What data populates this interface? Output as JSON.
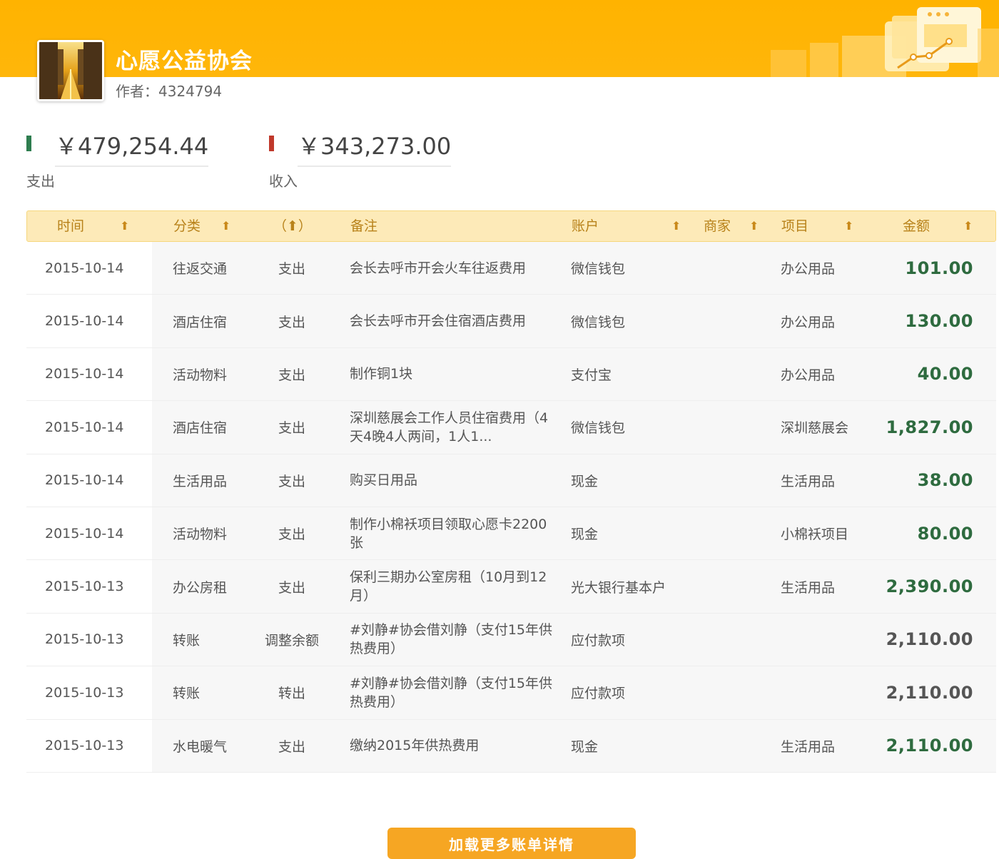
{
  "header": {
    "org_name": "心愿公益协会",
    "author": "作者：4324794"
  },
  "summary": {
    "expense_amount": "￥479,254.44",
    "expense_label": "支出",
    "expense_color": "#2e7d4f",
    "income_amount": "￥343,273.00",
    "income_label": "收入",
    "income_color": "#c0392b"
  },
  "table": {
    "headers": {
      "time": "时间",
      "category": "分类",
      "type": "（⬆）",
      "note": "备注",
      "account": "账户",
      "merchant": "商家",
      "project": "项目",
      "amount": "金额"
    },
    "sort_icon": "up-arrow-icon",
    "rows": [
      {
        "date": "2015-10-14",
        "category": "往返交通",
        "type": "支出",
        "note": "会长去呼市开会火车往返费用",
        "account": "微信钱包",
        "project": "办公用品",
        "amount": "101.00",
        "amount_color": "#2e6b3f"
      },
      {
        "date": "2015-10-14",
        "category": "酒店住宿",
        "type": "支出",
        "note": "会长去呼市开会住宿酒店费用",
        "account": "微信钱包",
        "project": "办公用品",
        "amount": "130.00",
        "amount_color": "#2e6b3f"
      },
      {
        "date": "2015-10-14",
        "category": "活动物料",
        "type": "支出",
        "note": "制作铜1块",
        "account": "支付宝",
        "project": "办公用品",
        "amount": "40.00",
        "amount_color": "#2e6b3f"
      },
      {
        "date": "2015-10-14",
        "category": "酒店住宿",
        "type": "支出",
        "note": "深圳慈展会工作人员住宿费用（4天4晚4人两间，1人1...",
        "account": "微信钱包",
        "project": "深圳慈展会",
        "amount": "1,827.00",
        "amount_color": "#2e6b3f"
      },
      {
        "date": "2015-10-14",
        "category": "生活用品",
        "type": "支出",
        "note": "购买日用品",
        "account": "现金",
        "project": "生活用品",
        "amount": "38.00",
        "amount_color": "#2e6b3f"
      },
      {
        "date": "2015-10-14",
        "category": "活动物料",
        "type": "支出",
        "note": "制作小棉袄项目领取心愿卡2200张",
        "account": "现金",
        "project": "小棉袄项目",
        "amount": "80.00",
        "amount_color": "#2e6b3f"
      },
      {
        "date": "2015-10-13",
        "category": "办公房租",
        "type": "支出",
        "note": "保利三期办公室房租（10月到12月）",
        "account": "光大银行基本户",
        "project": "生活用品",
        "amount": "2,390.00",
        "amount_color": "#2e6b3f"
      },
      {
        "date": "2015-10-13",
        "category": "转账",
        "type": "调整余额",
        "note": "#刘静#协会借刘静（支付15年供热费用）",
        "account": "应付款项",
        "project": "",
        "amount": "2,110.00",
        "amount_color": "#555555"
      },
      {
        "date": "2015-10-13",
        "category": "转账",
        "type": "转出",
        "note": "#刘静#协会借刘静（支付15年供热费用）",
        "account": "应付款项",
        "project": "",
        "amount": "2,110.00",
        "amount_color": "#555555"
      },
      {
        "date": "2015-10-13",
        "category": "水电暖气",
        "type": "支出",
        "note": "缴纳2015年供热费用",
        "account": "现金",
        "project": "生活用品",
        "amount": "2,110.00",
        "amount_color": "#2e6b3f"
      }
    ]
  },
  "load_more": "加载更多账单详情"
}
